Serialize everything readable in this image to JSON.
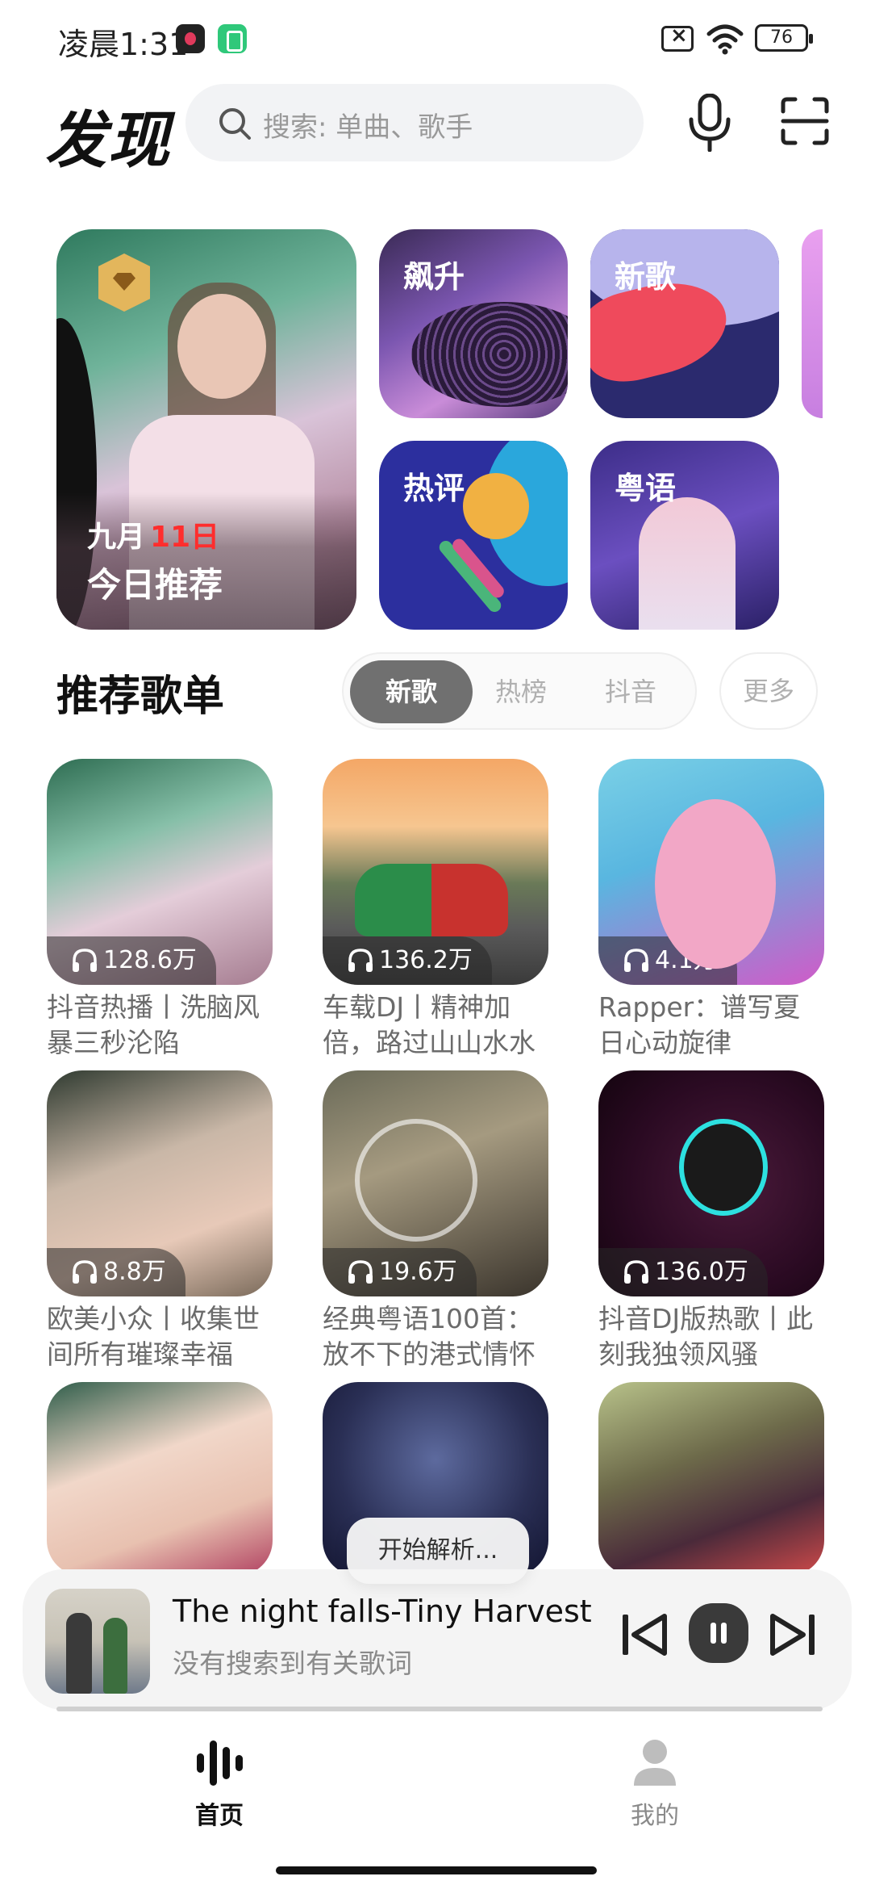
{
  "status_bar": {
    "time": "凌晨1:31",
    "battery": "76"
  },
  "header": {
    "title": "发现",
    "search_placeholder": "搜索: 单曲、歌手"
  },
  "features": {
    "daily": {
      "month": "九月",
      "day": "11日",
      "title": "今日推荐"
    },
    "tiles": [
      "飙升",
      "新歌",
      "热评",
      "粤语"
    ]
  },
  "section": {
    "title": "推荐歌单",
    "tabs": [
      "新歌",
      "热榜",
      "抖音"
    ],
    "active_tab": "新歌",
    "more": "更多"
  },
  "playlists": [
    {
      "count": "128.6万",
      "title": "抖音热播丨洗脑风暴三秒沦陷"
    },
    {
      "count": "136.2万",
      "title": "车载DJ丨精神加倍，路过山山水水"
    },
    {
      "count": "4.1万",
      "title": "Rapper：谱写夏日心动旋律"
    },
    {
      "count": "8.8万",
      "title": "欧美小众丨收集世间所有璀璨幸福"
    },
    {
      "count": "19.6万",
      "title": "经典粤语100首：放不下的港式情怀"
    },
    {
      "count": "136.0万",
      "title": "抖音DJ版热歌丨此刻我独领风骚"
    },
    {
      "count": "",
      "title": ""
    },
    {
      "count": "",
      "title": ""
    },
    {
      "count": "",
      "title": ""
    }
  ],
  "toast": "开始解析...",
  "player": {
    "track": "The night falls-Tiny Harvest",
    "lyrics_status": "没有搜索到有关歌词",
    "progress": 0.0
  },
  "nav": {
    "home": "首页",
    "mine": "我的"
  },
  "colors": {
    "accent_active_tab": "#707070",
    "date_highlight": "#ff2d2d"
  }
}
